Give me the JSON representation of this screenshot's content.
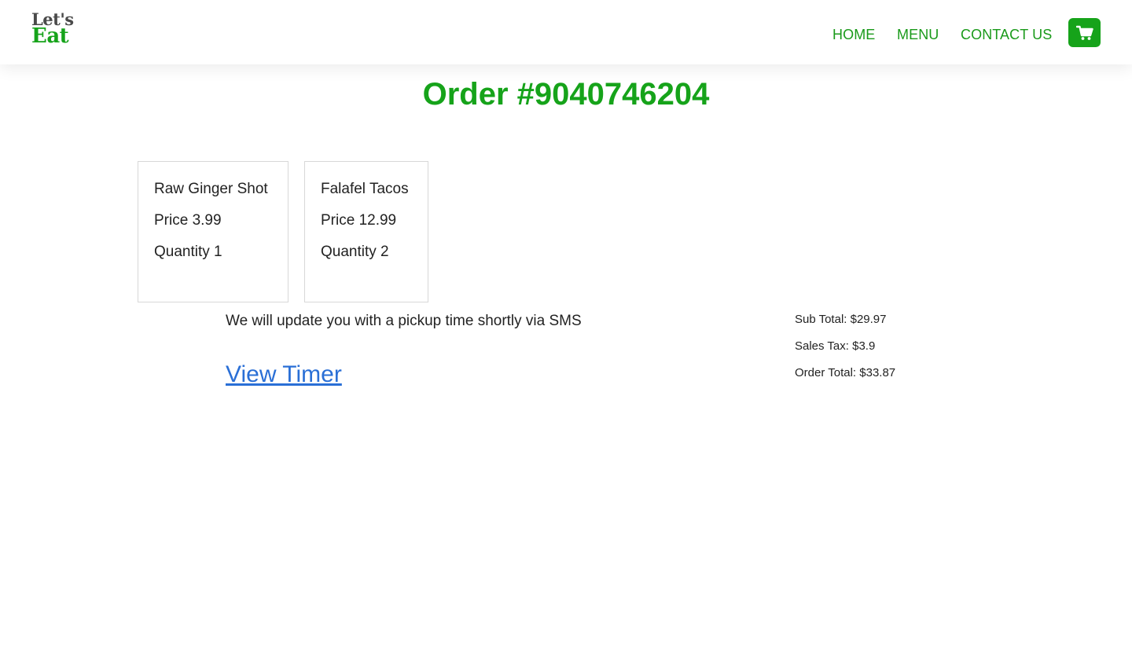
{
  "header": {
    "logo_top": "Let's",
    "logo_bottom": "Eat",
    "nav": {
      "home": "HOME",
      "menu": "MENU",
      "contact": "CONTACT US"
    },
    "cart_icon": "shopping-cart-icon"
  },
  "order": {
    "title": "Order #9040746204",
    "items": [
      {
        "name": "Raw Ginger Shot",
        "price": "Price 3.99",
        "quantity": "Quantity 1"
      },
      {
        "name": "Falafel Tacos",
        "price": "Price 12.99",
        "quantity": "Quantity 2"
      }
    ],
    "notice": "We will update you with a pickup time shortly via SMS",
    "timer_link": "View Timer",
    "totals": {
      "subtotal": "Sub Total: $29.97",
      "tax": "Sales Tax: $3.9",
      "total": "Order Total: $33.87"
    }
  },
  "colors": {
    "brand_green": "#16a31a",
    "logo_gray": "#4a4a4a",
    "link_blue": "#2a6fd6"
  }
}
